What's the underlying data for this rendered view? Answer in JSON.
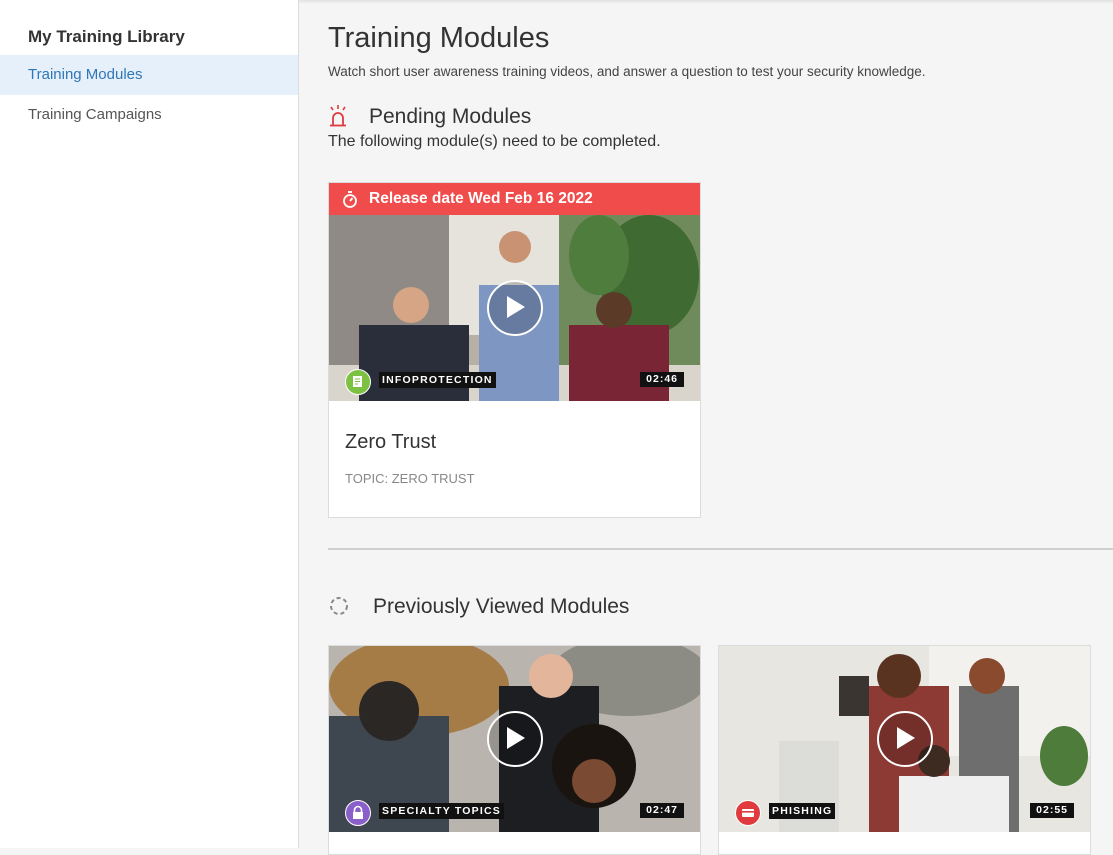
{
  "sidebar": {
    "title": "My Training Library",
    "items": [
      {
        "label": "Training Modules",
        "active": true
      },
      {
        "label": "Training Campaigns",
        "active": false
      }
    ]
  },
  "page": {
    "title": "Training Modules",
    "subtitle": "Watch short user awareness training videos, and answer a question to test your security knowledge."
  },
  "pending": {
    "heading": "Pending Modules",
    "description": "The following module(s) need to be completed.",
    "icon": "alarm-icon",
    "modules": [
      {
        "release": "Release date Wed Feb 16 2022",
        "category": "INFOPROTECTION",
        "category_icon": "document-icon",
        "category_color": "#7cc142",
        "duration": "02:46",
        "title": "Zero Trust",
        "topic": "TOPIC: ZERO TRUST"
      }
    ]
  },
  "previous": {
    "heading": "Previously Viewed Modules",
    "icon": "loading-spinner-icon",
    "modules": [
      {
        "category": "SPECIALTY TOPICS",
        "category_icon": "lock-icon",
        "category_color": "#8b5fc9",
        "duration": "02:47"
      },
      {
        "category": "PHISHING",
        "category_icon": "credit-card-icon",
        "category_color": "#e03a3e",
        "duration": "02:55"
      }
    ]
  },
  "colors": {
    "accent": "#2f76b8",
    "alert": "#f04c4c",
    "active_bg": "#e6f0fa"
  }
}
